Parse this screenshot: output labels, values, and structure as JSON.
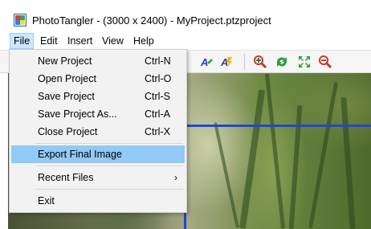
{
  "window": {
    "title": "PhotoTangler - (3000 x 2400) - MyProject.ptzproject"
  },
  "menubar": {
    "items": [
      "File",
      "Edit",
      "Insert",
      "View",
      "Help"
    ]
  },
  "file_menu": {
    "items": [
      {
        "label": "New Project",
        "shortcut": "Ctrl-N"
      },
      {
        "label": "Open Project",
        "shortcut": "Ctrl-O"
      },
      {
        "label": "Save Project",
        "shortcut": "Ctrl-S"
      },
      {
        "label": "Save Project As...",
        "shortcut": "Ctrl-A"
      },
      {
        "label": "Close Project",
        "shortcut": "Ctrl-X"
      },
      {
        "label": "Export Final Image",
        "shortcut": ""
      },
      {
        "label": "Recent Files",
        "shortcut": ""
      },
      {
        "label": "Exit",
        "shortcut": ""
      }
    ],
    "highlighted": "Export Final Image",
    "submenu_arrow": "›"
  },
  "toolbar": {
    "icons": [
      "text-fill-icon",
      "text-effect-icon",
      "zoom-in-icon",
      "refresh-icon",
      "resize-icon",
      "zoom-out-icon"
    ]
  },
  "colors": {
    "menu_highlight": "#91c9f7",
    "selection_outline": "#2046d8"
  }
}
